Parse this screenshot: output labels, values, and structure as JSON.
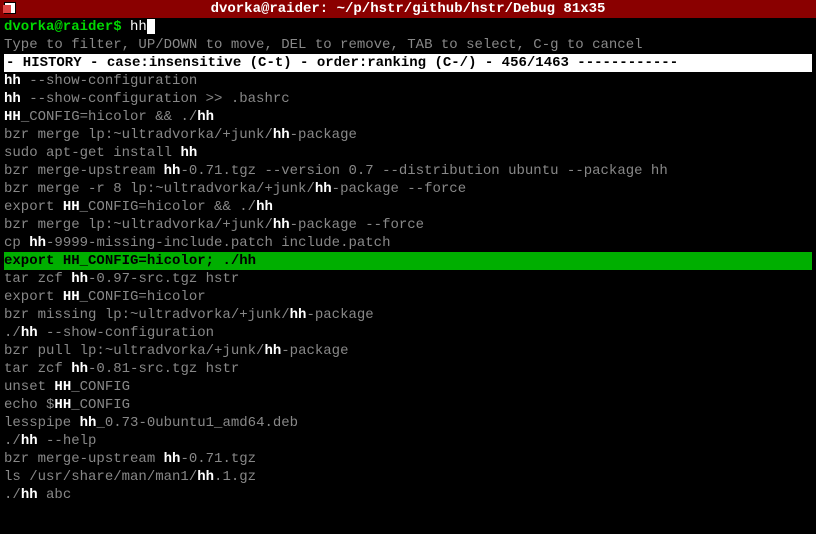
{
  "titlebar": {
    "title": "dvorka@raider: ~/p/hstr/github/hstr/Debug 81x35"
  },
  "prompt": {
    "user_host": "dvorka@raider$ ",
    "typed": "hh"
  },
  "hint": "Type to filter, UP/DOWN to move, DEL to remove, TAB to select, C-g to cancel",
  "status": "- HISTORY - case:insensitive (C-t) - order:ranking (C-/) - 456/1463 ------------",
  "history": [
    {
      "segs": [
        {
          "t": "hh",
          "hl": true
        },
        {
          "t": " --show-configuration"
        }
      ],
      "sel": false
    },
    {
      "segs": [
        {
          "t": "hh",
          "hl": true
        },
        {
          "t": " --show-configuration >> .bashrc"
        }
      ],
      "sel": false
    },
    {
      "segs": [
        {
          "t": "HH",
          "hl": true
        },
        {
          "t": "_CONFIG=hicolor && ./"
        },
        {
          "t": "hh",
          "hl": true
        }
      ],
      "sel": false
    },
    {
      "segs": [
        {
          "t": "bzr merge lp:~ultradvorka/+junk/"
        },
        {
          "t": "hh",
          "hl": true
        },
        {
          "t": "-package"
        }
      ],
      "sel": false
    },
    {
      "segs": [
        {
          "t": "sudo apt-get install "
        },
        {
          "t": "hh",
          "hl": true
        }
      ],
      "sel": false
    },
    {
      "segs": [
        {
          "t": "bzr merge-upstream "
        },
        {
          "t": "hh",
          "hl": true
        },
        {
          "t": "-0.71.tgz --version 0.7 --distribution ubuntu --package hh"
        }
      ],
      "sel": false
    },
    {
      "segs": [
        {
          "t": "bzr merge -r 8 lp:~ultradvorka/+junk/"
        },
        {
          "t": "hh",
          "hl": true
        },
        {
          "t": "-package --force"
        }
      ],
      "sel": false
    },
    {
      "segs": [
        {
          "t": "export "
        },
        {
          "t": "HH",
          "hl": true
        },
        {
          "t": "_CONFIG=hicolor && ./"
        },
        {
          "t": "hh",
          "hl": true
        }
      ],
      "sel": false
    },
    {
      "segs": [
        {
          "t": "bzr merge lp:~ultradvorka/+junk/"
        },
        {
          "t": "hh",
          "hl": true
        },
        {
          "t": "-package --force"
        }
      ],
      "sel": false
    },
    {
      "segs": [
        {
          "t": "cp "
        },
        {
          "t": "hh",
          "hl": true
        },
        {
          "t": "-9999-missing-include.patch include.patch"
        }
      ],
      "sel": false
    },
    {
      "segs": [
        {
          "t": "export "
        },
        {
          "t": "HH",
          "hl": true
        },
        {
          "t": "_CONFIG=hicolor; ./"
        },
        {
          "t": "hh",
          "hl": true
        }
      ],
      "sel": true
    },
    {
      "segs": [
        {
          "t": "tar zcf "
        },
        {
          "t": "hh",
          "hl": true
        },
        {
          "t": "-0.97-src.tgz hstr"
        }
      ],
      "sel": false
    },
    {
      "segs": [
        {
          "t": "export "
        },
        {
          "t": "HH",
          "hl": true
        },
        {
          "t": "_CONFIG=hicolor"
        }
      ],
      "sel": false
    },
    {
      "segs": [
        {
          "t": "bzr missing lp:~ultradvorka/+junk/"
        },
        {
          "t": "hh",
          "hl": true
        },
        {
          "t": "-package"
        }
      ],
      "sel": false
    },
    {
      "segs": [
        {
          "t": "./"
        },
        {
          "t": "hh",
          "hl": true
        },
        {
          "t": " --show-configuration"
        }
      ],
      "sel": false
    },
    {
      "segs": [
        {
          "t": "bzr pull lp:~ultradvorka/+junk/"
        },
        {
          "t": "hh",
          "hl": true
        },
        {
          "t": "-package"
        }
      ],
      "sel": false
    },
    {
      "segs": [
        {
          "t": "tar zcf "
        },
        {
          "t": "hh",
          "hl": true
        },
        {
          "t": "-0.81-src.tgz hstr"
        }
      ],
      "sel": false
    },
    {
      "segs": [
        {
          "t": "unset "
        },
        {
          "t": "HH",
          "hl": true
        },
        {
          "t": "_CONFIG"
        }
      ],
      "sel": false
    },
    {
      "segs": [
        {
          "t": "echo $"
        },
        {
          "t": "HH",
          "hl": true
        },
        {
          "t": "_CONFIG"
        }
      ],
      "sel": false
    },
    {
      "segs": [
        {
          "t": "lesspipe "
        },
        {
          "t": "hh",
          "hl": true
        },
        {
          "t": "_0.73-0ubuntu1_amd64.deb"
        }
      ],
      "sel": false
    },
    {
      "segs": [
        {
          "t": "./"
        },
        {
          "t": "hh",
          "hl": true
        },
        {
          "t": " --help"
        }
      ],
      "sel": false
    },
    {
      "segs": [
        {
          "t": "bzr merge-upstream "
        },
        {
          "t": "hh",
          "hl": true
        },
        {
          "t": "-0.71.tgz"
        }
      ],
      "sel": false
    },
    {
      "segs": [
        {
          "t": "ls /usr/share/man/man1/"
        },
        {
          "t": "hh",
          "hl": true
        },
        {
          "t": ".1.gz"
        }
      ],
      "sel": false
    },
    {
      "segs": [
        {
          "t": "./"
        },
        {
          "t": "hh",
          "hl": true
        },
        {
          "t": " abc"
        }
      ],
      "sel": false
    }
  ]
}
